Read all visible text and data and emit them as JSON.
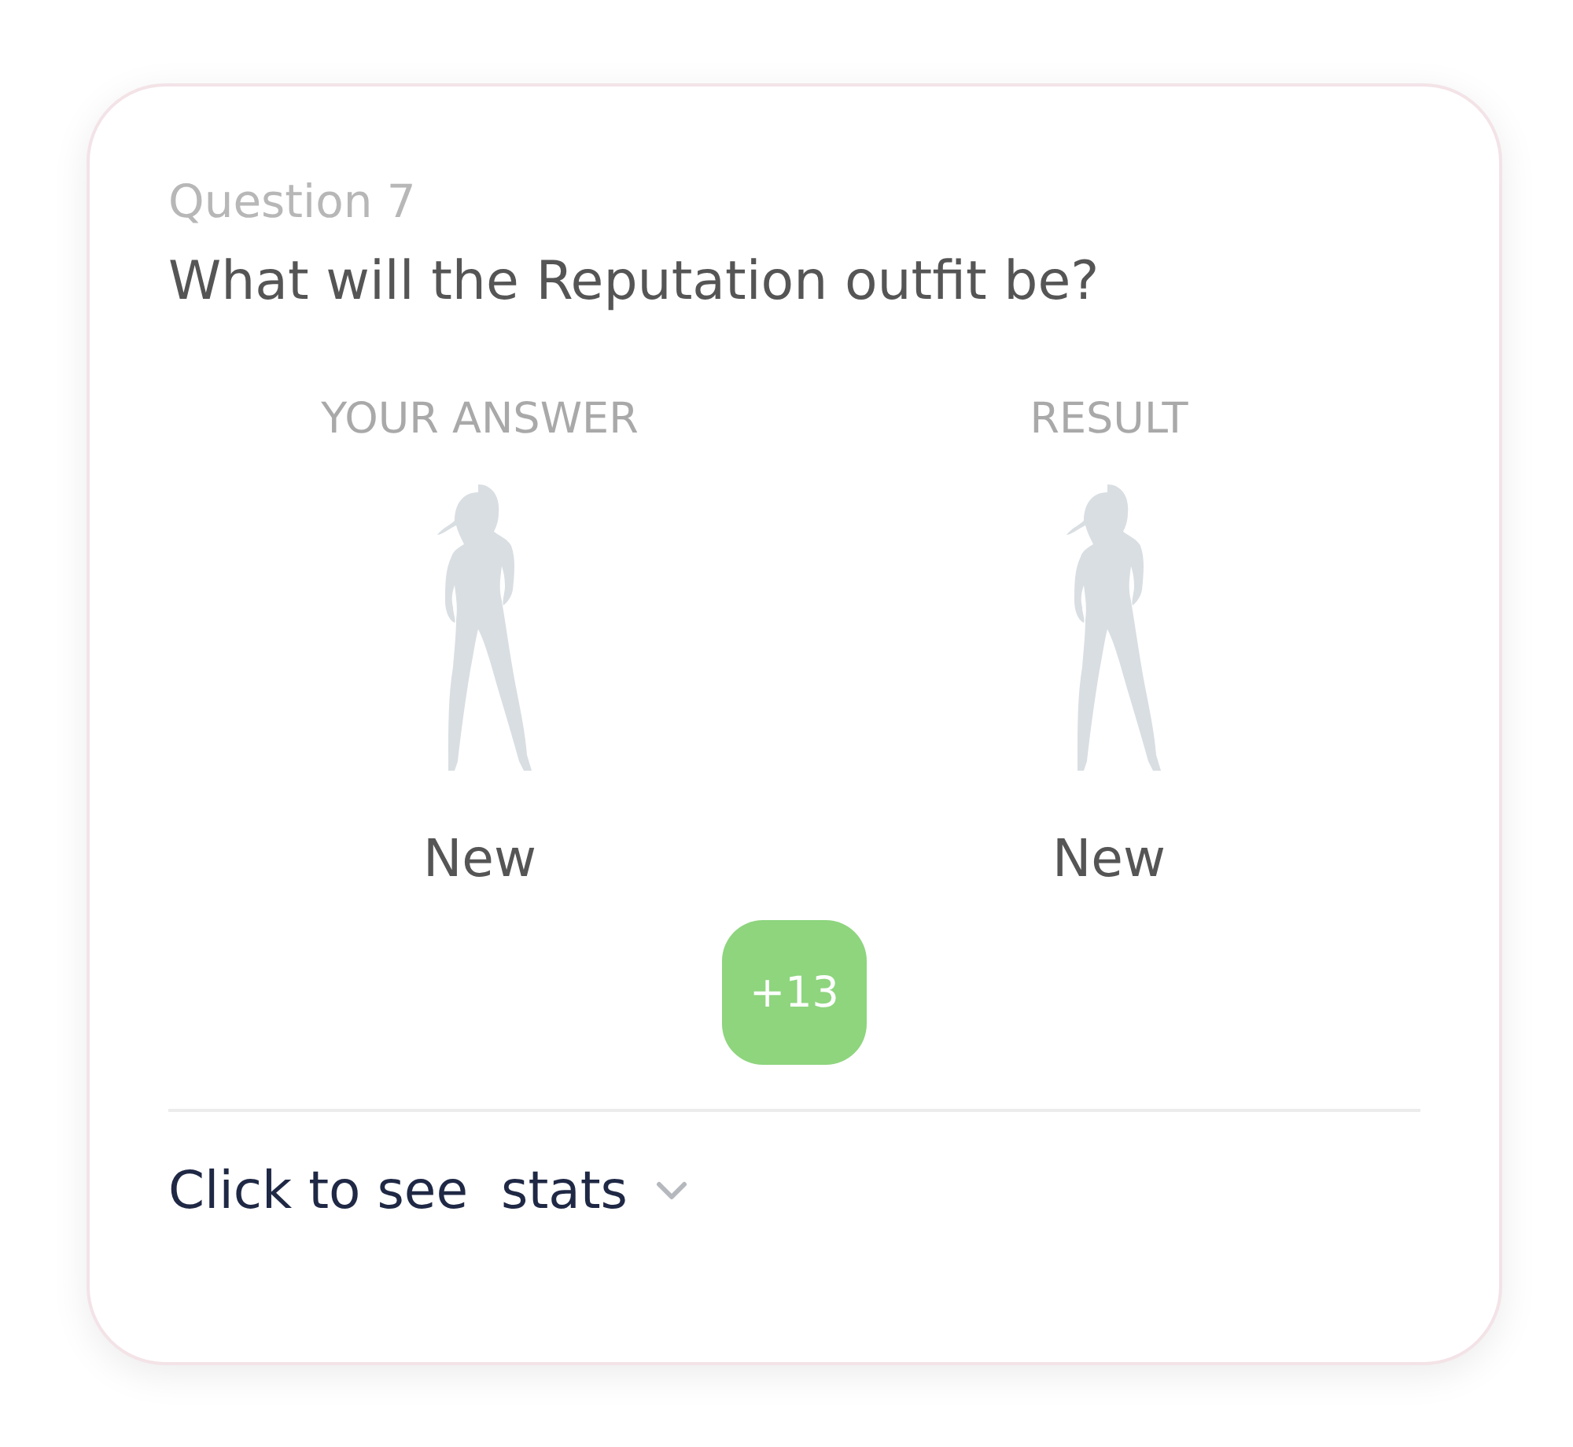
{
  "question": {
    "label": "Question 7",
    "text": "What will the Reputation outfit be?"
  },
  "answers": [
    {
      "heading": "YOUR ANSWER",
      "value": "New"
    },
    {
      "heading": "RESULT",
      "value": "New"
    }
  ],
  "points": "+13",
  "stats_toggle": {
    "label": "Click to see  stats",
    "expanded": false
  }
}
